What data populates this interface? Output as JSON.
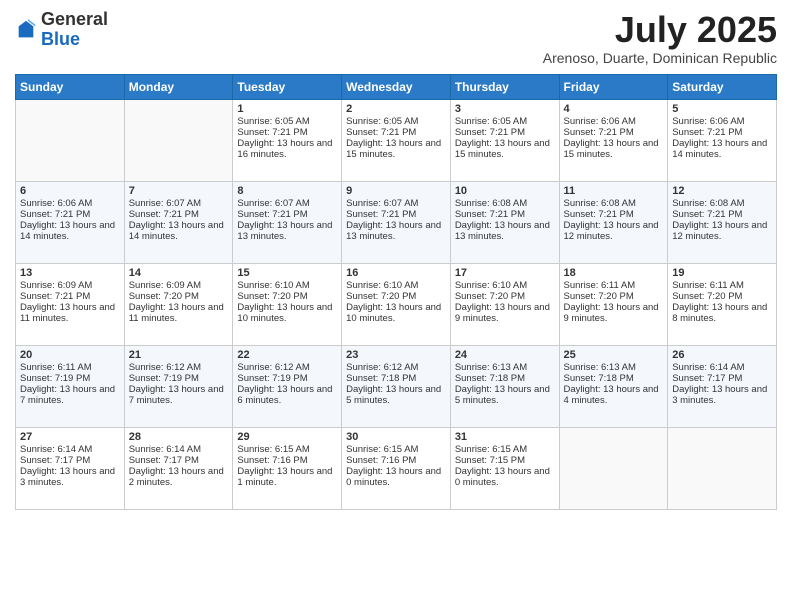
{
  "logo": {
    "general": "General",
    "blue": "Blue"
  },
  "header": {
    "month": "July 2025",
    "location": "Arenoso, Duarte, Dominican Republic"
  },
  "weekdays": [
    "Sunday",
    "Monday",
    "Tuesday",
    "Wednesday",
    "Thursday",
    "Friday",
    "Saturday"
  ],
  "weeks": [
    [
      {
        "day": "",
        "sunrise": "",
        "sunset": "",
        "daylight": ""
      },
      {
        "day": "",
        "sunrise": "",
        "sunset": "",
        "daylight": ""
      },
      {
        "day": "1",
        "sunrise": "Sunrise: 6:05 AM",
        "sunset": "Sunset: 7:21 PM",
        "daylight": "Daylight: 13 hours and 16 minutes."
      },
      {
        "day": "2",
        "sunrise": "Sunrise: 6:05 AM",
        "sunset": "Sunset: 7:21 PM",
        "daylight": "Daylight: 13 hours and 15 minutes."
      },
      {
        "day": "3",
        "sunrise": "Sunrise: 6:05 AM",
        "sunset": "Sunset: 7:21 PM",
        "daylight": "Daylight: 13 hours and 15 minutes."
      },
      {
        "day": "4",
        "sunrise": "Sunrise: 6:06 AM",
        "sunset": "Sunset: 7:21 PM",
        "daylight": "Daylight: 13 hours and 15 minutes."
      },
      {
        "day": "5",
        "sunrise": "Sunrise: 6:06 AM",
        "sunset": "Sunset: 7:21 PM",
        "daylight": "Daylight: 13 hours and 14 minutes."
      }
    ],
    [
      {
        "day": "6",
        "sunrise": "Sunrise: 6:06 AM",
        "sunset": "Sunset: 7:21 PM",
        "daylight": "Daylight: 13 hours and 14 minutes."
      },
      {
        "day": "7",
        "sunrise": "Sunrise: 6:07 AM",
        "sunset": "Sunset: 7:21 PM",
        "daylight": "Daylight: 13 hours and 14 minutes."
      },
      {
        "day": "8",
        "sunrise": "Sunrise: 6:07 AM",
        "sunset": "Sunset: 7:21 PM",
        "daylight": "Daylight: 13 hours and 13 minutes."
      },
      {
        "day": "9",
        "sunrise": "Sunrise: 6:07 AM",
        "sunset": "Sunset: 7:21 PM",
        "daylight": "Daylight: 13 hours and 13 minutes."
      },
      {
        "day": "10",
        "sunrise": "Sunrise: 6:08 AM",
        "sunset": "Sunset: 7:21 PM",
        "daylight": "Daylight: 13 hours and 13 minutes."
      },
      {
        "day": "11",
        "sunrise": "Sunrise: 6:08 AM",
        "sunset": "Sunset: 7:21 PM",
        "daylight": "Daylight: 13 hours and 12 minutes."
      },
      {
        "day": "12",
        "sunrise": "Sunrise: 6:08 AM",
        "sunset": "Sunset: 7:21 PM",
        "daylight": "Daylight: 13 hours and 12 minutes."
      }
    ],
    [
      {
        "day": "13",
        "sunrise": "Sunrise: 6:09 AM",
        "sunset": "Sunset: 7:21 PM",
        "daylight": "Daylight: 13 hours and 11 minutes."
      },
      {
        "day": "14",
        "sunrise": "Sunrise: 6:09 AM",
        "sunset": "Sunset: 7:20 PM",
        "daylight": "Daylight: 13 hours and 11 minutes."
      },
      {
        "day": "15",
        "sunrise": "Sunrise: 6:10 AM",
        "sunset": "Sunset: 7:20 PM",
        "daylight": "Daylight: 13 hours and 10 minutes."
      },
      {
        "day": "16",
        "sunrise": "Sunrise: 6:10 AM",
        "sunset": "Sunset: 7:20 PM",
        "daylight": "Daylight: 13 hours and 10 minutes."
      },
      {
        "day": "17",
        "sunrise": "Sunrise: 6:10 AM",
        "sunset": "Sunset: 7:20 PM",
        "daylight": "Daylight: 13 hours and 9 minutes."
      },
      {
        "day": "18",
        "sunrise": "Sunrise: 6:11 AM",
        "sunset": "Sunset: 7:20 PM",
        "daylight": "Daylight: 13 hours and 9 minutes."
      },
      {
        "day": "19",
        "sunrise": "Sunrise: 6:11 AM",
        "sunset": "Sunset: 7:20 PM",
        "daylight": "Daylight: 13 hours and 8 minutes."
      }
    ],
    [
      {
        "day": "20",
        "sunrise": "Sunrise: 6:11 AM",
        "sunset": "Sunset: 7:19 PM",
        "daylight": "Daylight: 13 hours and 7 minutes."
      },
      {
        "day": "21",
        "sunrise": "Sunrise: 6:12 AM",
        "sunset": "Sunset: 7:19 PM",
        "daylight": "Daylight: 13 hours and 7 minutes."
      },
      {
        "day": "22",
        "sunrise": "Sunrise: 6:12 AM",
        "sunset": "Sunset: 7:19 PM",
        "daylight": "Daylight: 13 hours and 6 minutes."
      },
      {
        "day": "23",
        "sunrise": "Sunrise: 6:12 AM",
        "sunset": "Sunset: 7:18 PM",
        "daylight": "Daylight: 13 hours and 5 minutes."
      },
      {
        "day": "24",
        "sunrise": "Sunrise: 6:13 AM",
        "sunset": "Sunset: 7:18 PM",
        "daylight": "Daylight: 13 hours and 5 minutes."
      },
      {
        "day": "25",
        "sunrise": "Sunrise: 6:13 AM",
        "sunset": "Sunset: 7:18 PM",
        "daylight": "Daylight: 13 hours and 4 minutes."
      },
      {
        "day": "26",
        "sunrise": "Sunrise: 6:14 AM",
        "sunset": "Sunset: 7:17 PM",
        "daylight": "Daylight: 13 hours and 3 minutes."
      }
    ],
    [
      {
        "day": "27",
        "sunrise": "Sunrise: 6:14 AM",
        "sunset": "Sunset: 7:17 PM",
        "daylight": "Daylight: 13 hours and 3 minutes."
      },
      {
        "day": "28",
        "sunrise": "Sunrise: 6:14 AM",
        "sunset": "Sunset: 7:17 PM",
        "daylight": "Daylight: 13 hours and 2 minutes."
      },
      {
        "day": "29",
        "sunrise": "Sunrise: 6:15 AM",
        "sunset": "Sunset: 7:16 PM",
        "daylight": "Daylight: 13 hours and 1 minute."
      },
      {
        "day": "30",
        "sunrise": "Sunrise: 6:15 AM",
        "sunset": "Sunset: 7:16 PM",
        "daylight": "Daylight: 13 hours and 0 minutes."
      },
      {
        "day": "31",
        "sunrise": "Sunrise: 6:15 AM",
        "sunset": "Sunset: 7:15 PM",
        "daylight": "Daylight: 13 hours and 0 minutes."
      },
      {
        "day": "",
        "sunrise": "",
        "sunset": "",
        "daylight": ""
      },
      {
        "day": "",
        "sunrise": "",
        "sunset": "",
        "daylight": ""
      }
    ]
  ]
}
